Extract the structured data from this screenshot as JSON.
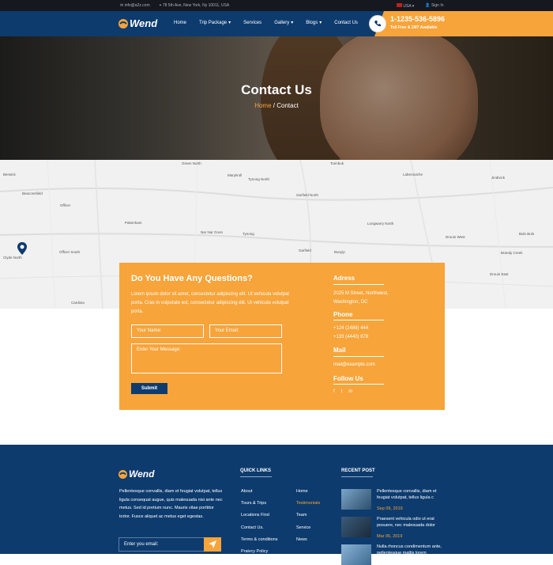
{
  "topbar": {
    "email": "info@a2z.com",
    "address": "78 5th Ave, New York, Ny 10011, USA",
    "lang": "USA",
    "signin": "Sign In"
  },
  "brand": {
    "name": "Wend"
  },
  "nav": {
    "items": [
      "Home",
      "Trip Package",
      "Services",
      "Gallery",
      "Blogs",
      "Contact Us"
    ]
  },
  "call": {
    "number": "1-1235-536-5896",
    "sub": "Toll Free & 24/7 Available"
  },
  "hero": {
    "title": "Contact Us",
    "crumb_home": "Home",
    "crumb_sep": " / ",
    "crumb_current": "Contact"
  },
  "map": {
    "labels": [
      "Berwick",
      "Green North",
      "Tonnbuk",
      "Laberoutche",
      "Jindivick",
      "Marykroll",
      "Tynong North",
      "Beaconsfield",
      "Officer",
      "Garfield North",
      "Pakenham",
      "Nar Nar Goon",
      "Tynong",
      "Longwarry North",
      "Drouin West",
      "Buln Buln",
      "Officer South",
      "Garfield",
      "Bunyip",
      "Brandy Creek",
      "Clyde North",
      "Drouin East",
      "Cardinia"
    ]
  },
  "form": {
    "title": "Do You Have Any Questions?",
    "text": "Lorem ipsum dolor sit amet, consectetur adipiscing elit. Ut vehicula volutpat porta. Cras in vulputate est, consectetur adipiscing elit. Ut vehicula volutpat porta.",
    "name_placeholder": "Your Name:",
    "email_placeholder": "Your Email:",
    "message_placeholder": "Enter Your Message:",
    "submit": "Submit"
  },
  "info": {
    "address_title": "Adress",
    "address_line1": "2025 M Street, Northwest,",
    "address_line2": "Washington, DC",
    "phone_title": "Phone",
    "phone1": "+124 (2486) 444",
    "phone2": "+133 (4440) 878",
    "mail_title": "Mail",
    "mail": "mail@example.com",
    "follow_title": "Follow Us"
  },
  "footer": {
    "about": "Pellentesque convallis, diam et feugiat volutpat, tellus ligula consequat augue, quis malesuada nisi ante nec metus. Sed id pretium nunc. Mauris vitae porttitor tortor. Fusce aliquet ac metus eget egestas.",
    "email_placeholder": "Enter you email:",
    "quick_title": "QUICK LINKS",
    "links_col1": [
      "About",
      "Tours & Trips",
      "Locations Find",
      "Contact Us.",
      "Terms & conditions",
      "Praivcy Policy"
    ],
    "links_col2": [
      "Home",
      "Testimonials",
      "Team",
      "Service",
      "News"
    ],
    "recent_title": "RECENT POST",
    "posts": [
      {
        "title": "Pellentesque convallis, diam et feugiat volutpat, tellus ligula c",
        "date": "Sep 09, 2019"
      },
      {
        "title": "Praesent vehicula odio ut erat posuere, nec malesuada dolor",
        "date": "Mar 06, 2019"
      },
      {
        "title": "Nulla rhoncus condimentum ante, pellentesque mattis lorem bibendum at",
        "date": ""
      }
    ]
  },
  "colors": {
    "brand": "#0d3b6e",
    "accent": "#f7a43a"
  }
}
